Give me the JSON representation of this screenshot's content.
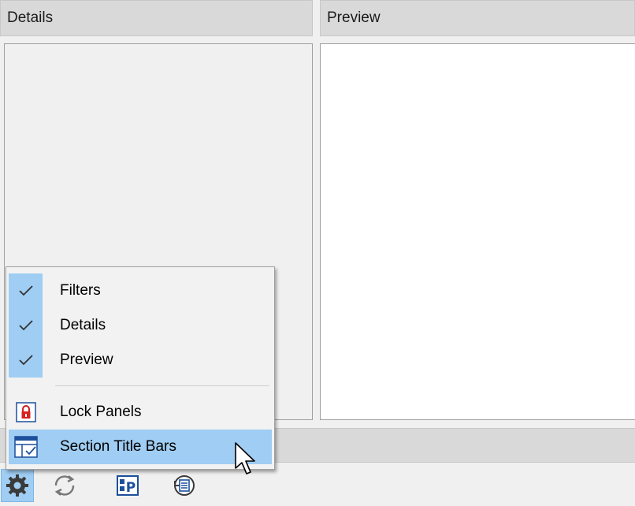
{
  "panels": {
    "details_title": "Details",
    "preview_title": "Preview"
  },
  "context_menu": {
    "items": [
      {
        "label": "Filters",
        "checked": true,
        "icon": "check-icon"
      },
      {
        "label": "Details",
        "checked": true,
        "icon": "check-icon"
      },
      {
        "label": "Preview",
        "checked": true,
        "icon": "check-icon"
      },
      {
        "label": "Lock Panels",
        "checked": false,
        "icon": "lock-icon"
      },
      {
        "label": "Section Title Bars",
        "checked": false,
        "icon": "section-title-bars-icon",
        "highlighted": true
      }
    ]
  },
  "toolbar": {
    "buttons": [
      {
        "name": "settings",
        "icon": "gear-icon",
        "active": true
      },
      {
        "name": "refresh",
        "icon": "refresh-icon"
      },
      {
        "name": "preview-pane",
        "icon": "preview-pane-icon"
      },
      {
        "name": "history",
        "icon": "history-icon"
      }
    ]
  },
  "colors": {
    "menu_highlight": "#9fcdf3",
    "title_bar": "#d9d9d9",
    "window_bg": "#f0f0f0"
  }
}
